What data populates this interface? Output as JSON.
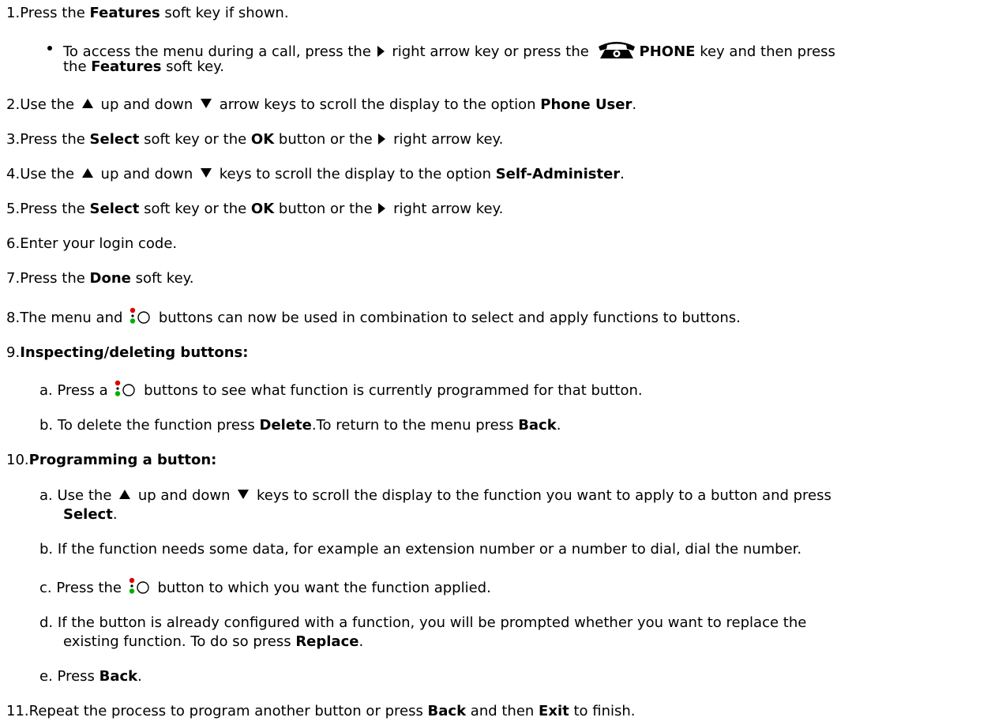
{
  "steps": {
    "s1": {
      "num": "1.",
      "a": "Press the ",
      "b": "Features",
      "c": " soft key if shown."
    },
    "s1_bullet": {
      "a": "To access the menu during a call, press the ",
      "b": " right arrow key or press the ",
      "c": "PHONE",
      "d": " key and then press",
      "e": "the ",
      "f": "Features",
      "g": " soft key."
    },
    "s2": {
      "num": "2.",
      "a": "Use the ",
      "b": " up and down ",
      "c": " arrow keys to scroll the display to the option ",
      "d": "Phone User",
      "e": "."
    },
    "s3": {
      "num": "3.",
      "a": "Press the ",
      "b": "Select",
      "c": " soft key or the ",
      "d": "OK",
      "e": " button or the ",
      "f": " right arrow key."
    },
    "s4": {
      "num": "4.",
      "a": "Use the ",
      "b": " up and down  ",
      "c": " keys to scroll the display to the option ",
      "d": "Self-Administer",
      "e": "."
    },
    "s5": {
      "num": "5.",
      "a": "Press the ",
      "b": "Select",
      "c": " soft key or the ",
      "d": "OK",
      "e": " button or the ",
      "f": " right arrow key."
    },
    "s6": {
      "num": "6.",
      "a": "Enter your login code."
    },
    "s7": {
      "num": "7.",
      "a": "Press the ",
      "b": "Done",
      "c": " soft key."
    },
    "s8": {
      "num": "8.",
      "a": "The menu and ",
      "b": " buttons can now be used in combination to select and apply functions to buttons."
    },
    "s9": {
      "num": "9.",
      "a": "Inspecting/deleting buttons:"
    },
    "s9a": {
      "num": "a.",
      "a": "Press a ",
      "b": " buttons to see what function is currently programmed for that button."
    },
    "s9b": {
      "num": "b.",
      "a": "To delete the function press ",
      "b": "Delete",
      "c": ".To return to the menu press ",
      "d": "Back",
      "e": "."
    },
    "s10": {
      "num": "10.",
      "a": "Programming a button:"
    },
    "s10a": {
      "num": "a.",
      "a": "Use the ",
      "b": " up and down  ",
      "c": " keys to scroll the display to the function you want to apply to a button and press",
      "d": "Select",
      "e": "."
    },
    "s10b": {
      "num": "b.",
      "a": "If the function needs some data, for example an extension number or a number to dial, dial the number."
    },
    "s10c": {
      "num": "c.",
      "a": "Press the ",
      "b": " button to which you want the function applied."
    },
    "s10d": {
      "num": "d.",
      "a": "If the button is already configured with a function, you will be prompted whether you want to replace the",
      "b": "existing function. To do so press ",
      "c": "Replace",
      "d": "."
    },
    "s10e": {
      "num": "e.",
      "a": "Press ",
      "b": "Back",
      "c": "."
    },
    "s11": {
      "num": "11.",
      "a": "Repeat the process to program another button or press ",
      "b": "Back",
      "c": " and then ",
      "d": "Exit",
      "e": " to finish."
    }
  },
  "icons": {
    "right_arrow": "right-arrow-key-icon",
    "up_arrow": "up-arrow-key-icon",
    "down_arrow": "down-arrow-key-icon",
    "phone": "phone-key-icon",
    "lamp_button": "programmable-button-lamp-icon"
  },
  "colors": {
    "lamp_red": "#e00000",
    "lamp_green": "#00b000",
    "text": "#000000"
  }
}
